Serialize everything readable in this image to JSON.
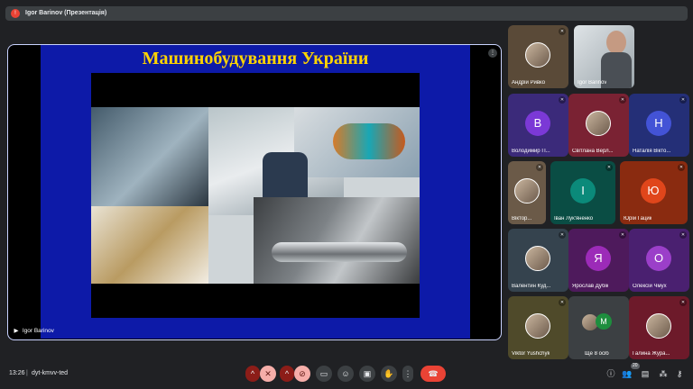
{
  "top": {
    "title": "Igor Barinov (Презентація)",
    "dot_label": "!"
  },
  "slide": {
    "title": "Машинобудування України"
  },
  "stage": {
    "presenter": "Igor Barinov"
  },
  "participants": [
    {
      "name": "Андрій Ривко",
      "kind": "photo"
    },
    {
      "name": "Igor Barinov",
      "kind": "video"
    },
    {
      "name": "Володимир П...",
      "initial": "В",
      "color": "#7b39d6"
    },
    {
      "name": "Світлана Верл...",
      "kind": "photo"
    },
    {
      "name": "Наталія Вікто...",
      "initial": "Н",
      "color": "#4353d6"
    },
    {
      "name": "Віктор...",
      "kind": "photo"
    },
    {
      "name": "Іван Лук'яненко",
      "initial": "І",
      "color": "#0b8a7a"
    },
    {
      "name": "Юрій Гацик",
      "initial": "Ю",
      "color": "#e0461b"
    },
    {
      "name": "Валентин Куд...",
      "kind": "photo"
    },
    {
      "name": "Ярослав Дубік",
      "initial": "Я",
      "color": "#9c2bb8"
    },
    {
      "name": "Олексій Чмух",
      "initial": "О",
      "color": "#9b3fc9"
    },
    {
      "name": "Viktor Yushchyk",
      "kind": "photo"
    },
    {
      "name": "Ще 8 осіб",
      "kind": "more",
      "initial": "M"
    },
    {
      "name": "Галина Жура...",
      "kind": "photo"
    }
  ],
  "bottom": {
    "time": "13:26",
    "meeting_code": "dyt-kmvv-ted",
    "badge": "20"
  },
  "icons": {
    "mic": "mic-off-icon",
    "cam": "camera-off-icon",
    "caption": "captions-icon",
    "emoji": "emoji-icon",
    "present": "present-icon",
    "hand": "raise-hand-icon",
    "more": "more-vert-icon",
    "end": "end-call-icon",
    "info": "info-icon",
    "people": "people-icon",
    "chat": "chat-icon",
    "activities": "activities-icon",
    "lock": "host-controls-icon"
  }
}
